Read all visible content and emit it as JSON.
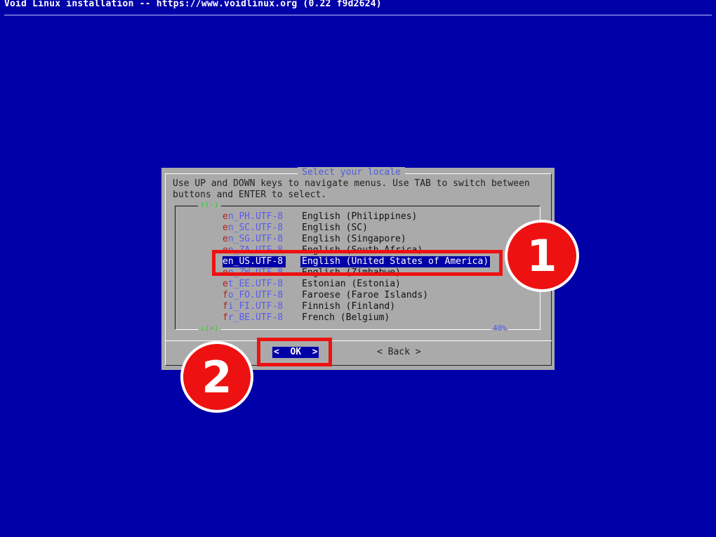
{
  "window": {
    "title": "Void Linux installation -- https://www.voidlinux.org (0.22 f9d2624)"
  },
  "dialog": {
    "title": "Select your locale",
    "instructions": "Use UP and DOWN keys to navigate menus. Use TAB to switch between\nbuttons and ENTER to select.",
    "scroll_up": "↑(-)",
    "scroll_down": "↓(+)",
    "percent": "40%",
    "items": [
      {
        "hot": "e",
        "rest": "n_PH.UTF-8",
        "desc": "English (Philippines)"
      },
      {
        "hot": "e",
        "rest": "n_SC.UTF-8",
        "desc": "English (SC)"
      },
      {
        "hot": "e",
        "rest": "n_SG.UTF-8",
        "desc": "English (Singapore)"
      },
      {
        "hot": "e",
        "rest": "n_ZA.UTF-8",
        "desc": "English (South Africa)"
      },
      {
        "hot": "e",
        "rest": "n_US.UTF-8",
        "desc": "English (United States of America)",
        "selected": true
      },
      {
        "hot": "e",
        "rest": "n_ZW.UTF-8",
        "desc": "English (Zimbabwe)"
      },
      {
        "hot": "e",
        "rest": "t_EE.UTF-8",
        "desc": "Estonian (Estonia)"
      },
      {
        "hot": "f",
        "rest": "o_FO.UTF-8",
        "desc": "Faroese (Faroe Islands)"
      },
      {
        "hot": "f",
        "rest": "i_FI.UTF-8",
        "desc": "Finnish (Finland)"
      },
      {
        "hot": "f",
        "rest": "r_BE.UTF-8",
        "desc": "French (Belgium)"
      }
    ],
    "buttons": {
      "ok_label": "OK",
      "back_label": "Back"
    }
  },
  "annotations": {
    "badge_1": "1",
    "badge_2": "2",
    "color": "#ee1111"
  },
  "colors": {
    "background": "#0000a8",
    "dialog": "#aaaaaa",
    "title_accent": "#4d5ce0",
    "hotkey": "#b81c1c"
  }
}
